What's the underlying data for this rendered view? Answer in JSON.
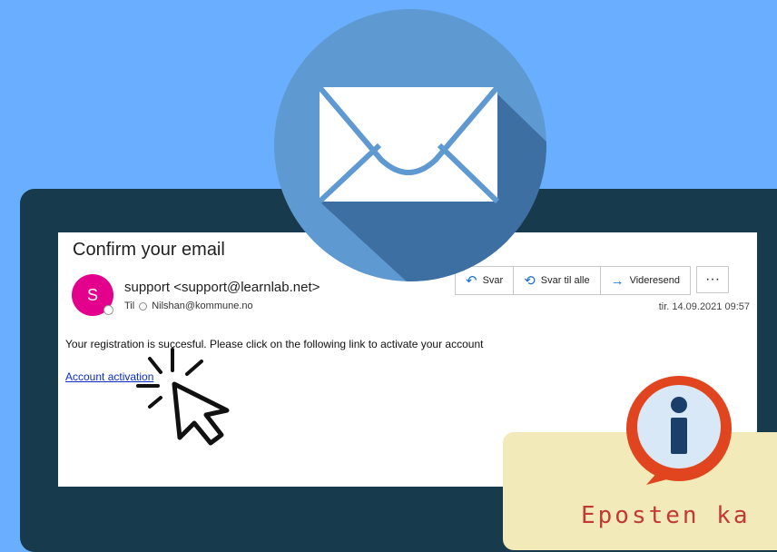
{
  "email": {
    "subject": "Confirm your email",
    "avatar_letter": "S",
    "sender": "support <support@learnlab.net>",
    "to_label": "Til",
    "recipient": "Nilshan@kommune.no",
    "date": "tir. 14.09.2021 09:57",
    "body": "Your registration is succesful. Please click on the following link to activate your account",
    "link_text": "Account activation"
  },
  "actions": {
    "reply": "Svar",
    "reply_all": "Svar til alle",
    "forward": "Videresend",
    "more": "···"
  },
  "note": {
    "text": "Eposten ka"
  },
  "icons": [
    "envelope-icon",
    "info-icon",
    "cursor-click-icon",
    "reply-icon",
    "reply-all-icon",
    "forward-icon",
    "more-icon"
  ],
  "colors": {
    "background": "#6aafff",
    "laptop": "#183a4d",
    "avatar": "#e3008c",
    "link": "#0b2cc9",
    "note": "#f2eab8",
    "note_text": "#c23a32",
    "info": "#e0451f"
  }
}
